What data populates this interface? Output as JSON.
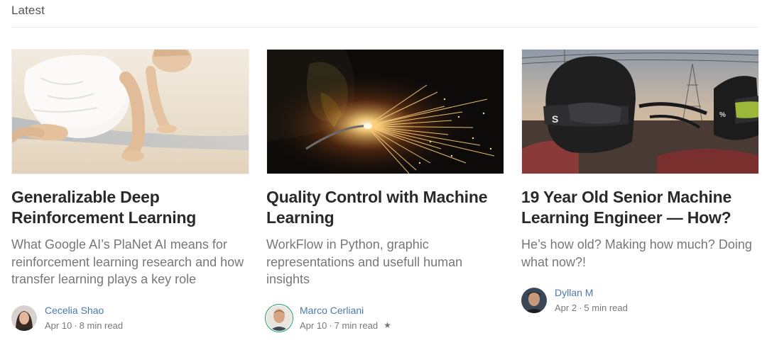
{
  "section": {
    "title": "Latest"
  },
  "cards": [
    {
      "title": "Generalizable Deep Reinforcement Learning",
      "subtitle": "What Google AI’s PlaNet AI means for reinforcement learning research and how transfer learning plays a key role",
      "author": "Cecelia Shao",
      "date": "Apr 10",
      "separator": "·",
      "read_time": "8 min read",
      "image": "baby-crawling-on-sand-photo"
    },
    {
      "title": "Quality Control with Machine Learning",
      "subtitle": "WorkFlow in Python, graphic representations and usefull human insights",
      "author": "Marco Cerliani",
      "date": "Apr 10",
      "separator": "·",
      "read_time": "7 min read",
      "member_star": "★",
      "image": "welding-sparks-photo"
    },
    {
      "title": "19 Year Old Senior Machine Learning Engineer — How?",
      "subtitle": "He’s how old? Making how much? Doing what now?!",
      "author": "Dyllan M",
      "date": "Apr 2",
      "separator": "·",
      "read_time": "5 min read",
      "image": "motocross-helmets-photo"
    }
  ],
  "colors": {
    "author_link": "#4a7ab0",
    "member_ring": "#1c9963",
    "muted_text": "rgba(0,0,0,0.54)",
    "title_text": "rgba(0,0,0,0.84)"
  }
}
